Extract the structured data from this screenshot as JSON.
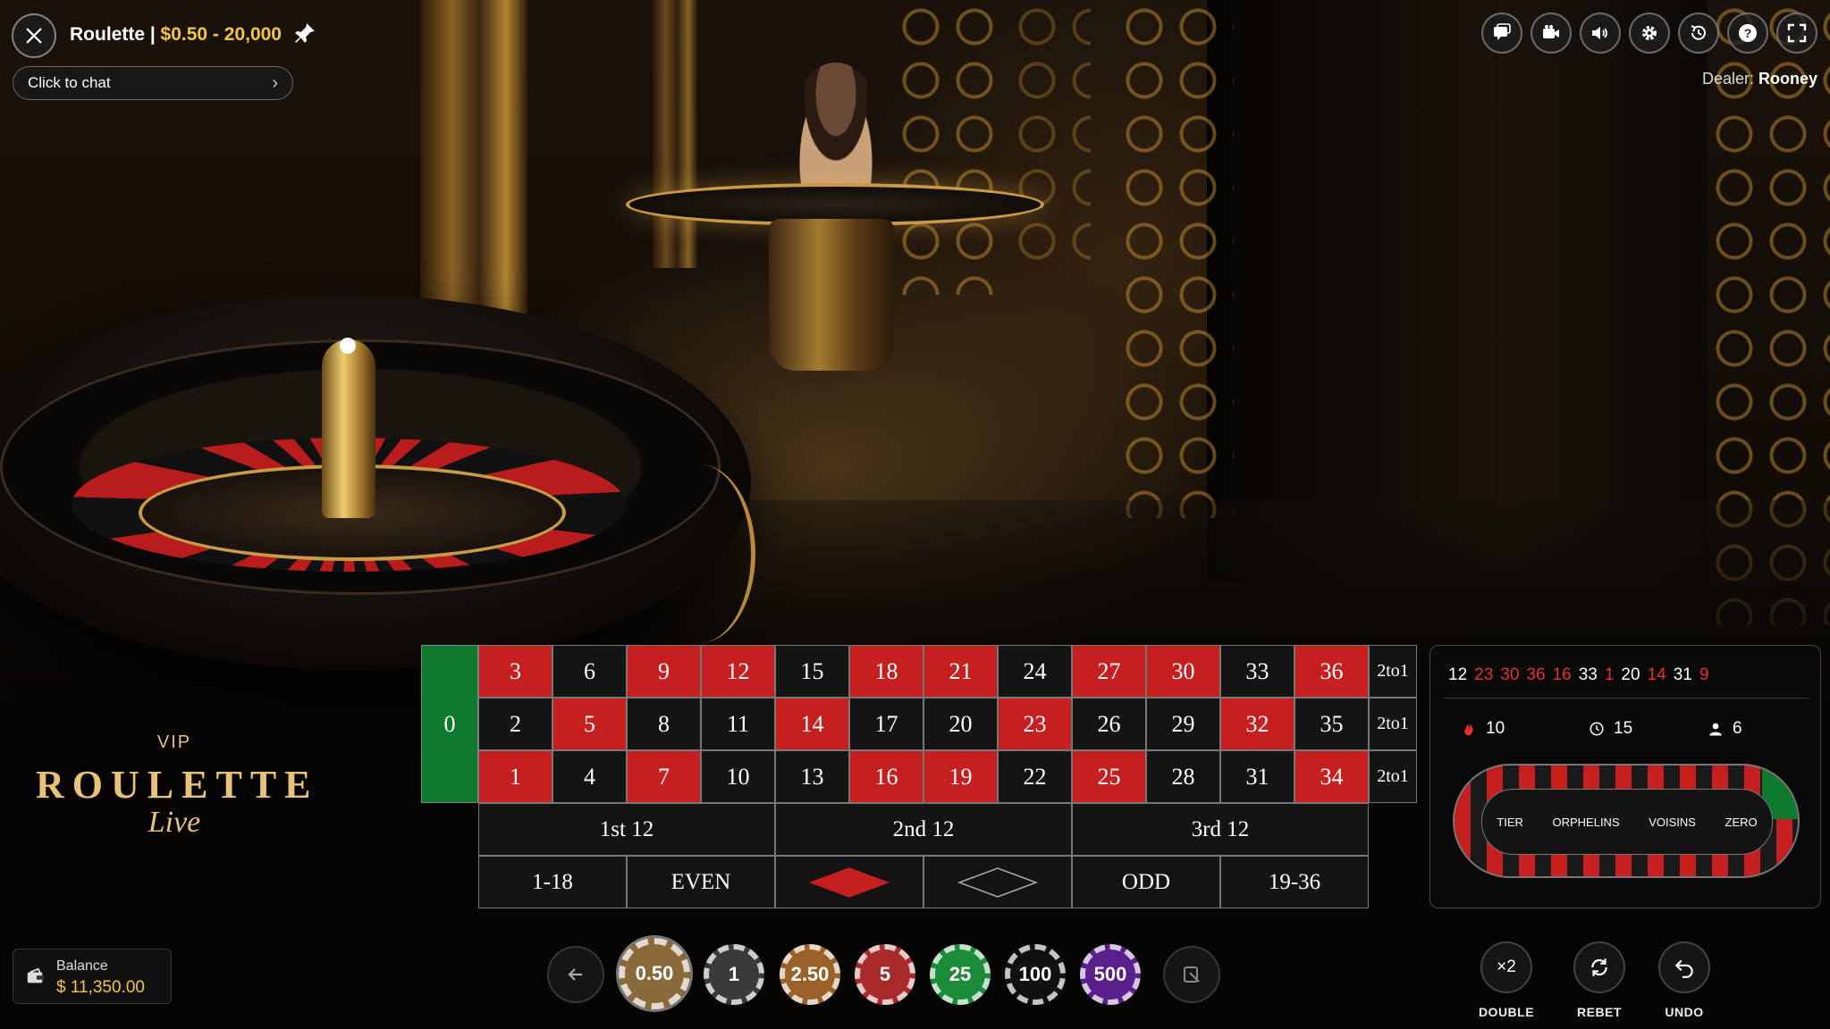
{
  "header": {
    "game_name": "Roulette",
    "separator": " | ",
    "limits": "$0.50 - 20,000",
    "chat_placeholder": "Click to chat",
    "dealer_prefix": "Dealer: ",
    "dealer_name": "Rooney",
    "icons": [
      "chat-icon",
      "video-icon",
      "sound-icon",
      "settings-icon",
      "history-icon",
      "help-icon",
      "fullscreen-icon"
    ]
  },
  "logo": {
    "tag": "VIP",
    "main": "ROULETTE",
    "sub": "Live"
  },
  "table": {
    "zero": "0",
    "rows": [
      [
        {
          "n": "3",
          "c": "red"
        },
        {
          "n": "6",
          "c": "black"
        },
        {
          "n": "9",
          "c": "red"
        },
        {
          "n": "12",
          "c": "red"
        },
        {
          "n": "15",
          "c": "black"
        },
        {
          "n": "18",
          "c": "red"
        },
        {
          "n": "21",
          "c": "red"
        },
        {
          "n": "24",
          "c": "black"
        },
        {
          "n": "27",
          "c": "red"
        },
        {
          "n": "30",
          "c": "red"
        },
        {
          "n": "33",
          "c": "black"
        },
        {
          "n": "36",
          "c": "red"
        }
      ],
      [
        {
          "n": "2",
          "c": "black"
        },
        {
          "n": "5",
          "c": "red"
        },
        {
          "n": "8",
          "c": "black"
        },
        {
          "n": "11",
          "c": "black"
        },
        {
          "n": "14",
          "c": "red"
        },
        {
          "n": "17",
          "c": "black"
        },
        {
          "n": "20",
          "c": "black"
        },
        {
          "n": "23",
          "c": "red"
        },
        {
          "n": "26",
          "c": "black"
        },
        {
          "n": "29",
          "c": "black"
        },
        {
          "n": "32",
          "c": "red"
        },
        {
          "n": "35",
          "c": "black"
        }
      ],
      [
        {
          "n": "1",
          "c": "red"
        },
        {
          "n": "4",
          "c": "black"
        },
        {
          "n": "7",
          "c": "red"
        },
        {
          "n": "10",
          "c": "black"
        },
        {
          "n": "13",
          "c": "black"
        },
        {
          "n": "16",
          "c": "red"
        },
        {
          "n": "19",
          "c": "red"
        },
        {
          "n": "22",
          "c": "black"
        },
        {
          "n": "25",
          "c": "red"
        },
        {
          "n": "28",
          "c": "black"
        },
        {
          "n": "31",
          "c": "black"
        },
        {
          "n": "34",
          "c": "red"
        }
      ]
    ],
    "column_bet": "2to1",
    "dozens": [
      "1st 12",
      "2nd 12",
      "3rd 12"
    ],
    "outside": [
      "1-18",
      "EVEN",
      "RED",
      "BLACK",
      "ODD",
      "19-36"
    ]
  },
  "stats": {
    "history": [
      {
        "n": "12",
        "c": "black"
      },
      {
        "n": "23",
        "c": "red"
      },
      {
        "n": "30",
        "c": "red"
      },
      {
        "n": "36",
        "c": "red"
      },
      {
        "n": "16",
        "c": "red"
      },
      {
        "n": "33",
        "c": "black"
      },
      {
        "n": "1",
        "c": "red"
      },
      {
        "n": "20",
        "c": "black"
      },
      {
        "n": "14",
        "c": "red"
      },
      {
        "n": "31",
        "c": "black"
      },
      {
        "n": "9",
        "c": "red"
      }
    ],
    "hot": "10",
    "rounds": "15",
    "players": "6",
    "racetrack": [
      "TIER",
      "ORPHELINS",
      "VOISINS",
      "ZERO"
    ]
  },
  "balance": {
    "label": "Balance",
    "value": "$ 11,350.00"
  },
  "chips": [
    {
      "v": "0.50",
      "color": "#8a6a3a",
      "selected": true
    },
    {
      "v": "1",
      "color": "#3a3a3a",
      "selected": false
    },
    {
      "v": "2.50",
      "color": "#9a6228",
      "selected": false
    },
    {
      "v": "5",
      "color": "#a82a2a",
      "selected": false
    },
    {
      "v": "25",
      "color": "#1c8c3a",
      "selected": false
    },
    {
      "v": "100",
      "color": "#111111",
      "selected": false
    },
    {
      "v": "500",
      "color": "#5a1f8a",
      "selected": false
    }
  ],
  "actions": {
    "double_icon": "×2",
    "double": "DOUBLE",
    "rebet": "REBET",
    "undo": "UNDO"
  }
}
